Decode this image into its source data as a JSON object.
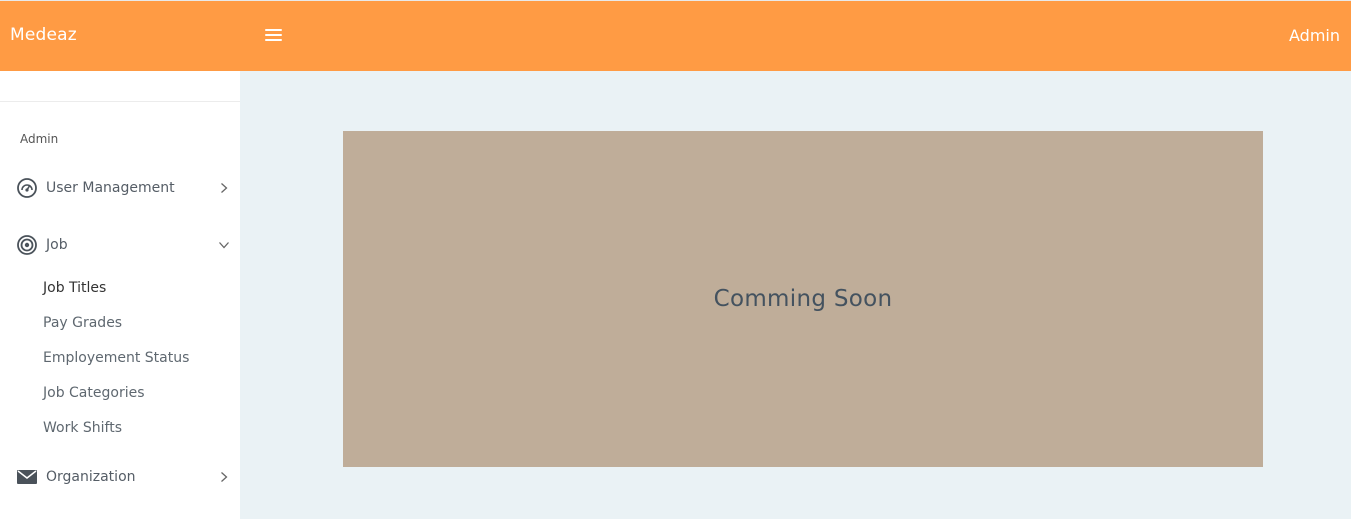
{
  "header": {
    "brand": "Medeaz",
    "user": "Admin",
    "menu_icon": "hamburger-icon",
    "color": "#ff9b44"
  },
  "sidebar": {
    "section_title": "Admin",
    "items": [
      {
        "label": "User Management",
        "icon": "dashboard-gauge-icon",
        "arrow": "chevron-right-icon"
      },
      {
        "label": "Job",
        "icon": "target-icon",
        "arrow": "chevron-down-icon",
        "subitems": [
          "Job Titles",
          "Pay Grades",
          "Employement Status",
          "Job Categories",
          "Work Shifts"
        ],
        "active_subitem": "Job Titles"
      },
      {
        "label": "Organization",
        "icon": "envelope-icon",
        "arrow": "chevron-right-icon"
      }
    ]
  },
  "main": {
    "placeholder_text": "Comming Soon",
    "panel_color": "#bfad99"
  }
}
